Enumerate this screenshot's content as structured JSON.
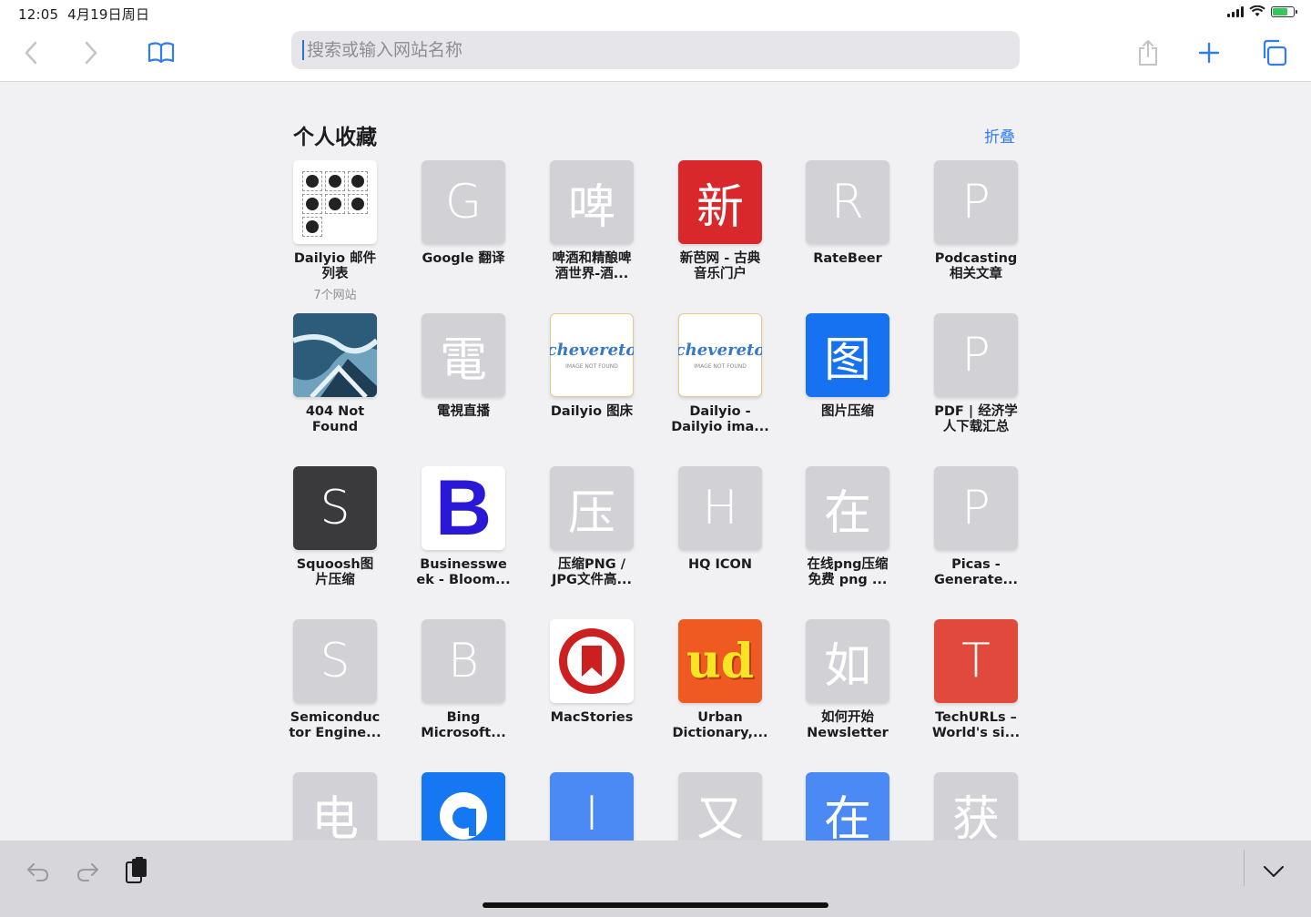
{
  "status": {
    "time": "12:05",
    "date": "4月19日周日"
  },
  "toolbar": {
    "address_placeholder": "搜索或输入网站名称"
  },
  "favorites": {
    "title": "个人收藏",
    "collapse_label": "折叠",
    "items": [
      {
        "label": "Dailyio 邮件\n列表",
        "sub": "7个网站",
        "tile": "",
        "color": "#ffffff"
      },
      {
        "label": "Google 翻译",
        "tile": "G",
        "color": "#d2d2d6"
      },
      {
        "label": "啤酒和精酿啤\n酒世界-酒...",
        "tile": "啤",
        "color": "#d2d2d6"
      },
      {
        "label": "新芭网 - 古典\n音乐门户",
        "tile": "新",
        "color": "#d9282b"
      },
      {
        "label": "RateBeer",
        "tile": "R",
        "color": "#d2d2d6"
      },
      {
        "label": "Podcasting\n相关文章",
        "tile": "P",
        "color": "#d2d2d6"
      },
      {
        "label": "404 Not\nFound",
        "tile": "",
        "color": "#3d6d8c"
      },
      {
        "label": "電視直播",
        "tile": "電",
        "color": "#d2d2d6"
      },
      {
        "label": "Dailyio 图床",
        "tile": "chevereto",
        "color": "#ffffff"
      },
      {
        "label": "Dailyio -\nDailyio ima...",
        "tile": "chevereto",
        "color": "#ffffff"
      },
      {
        "label": "图片压缩",
        "tile": "图",
        "color": "#1672f0"
      },
      {
        "label": "PDF | 经济学\n人下载汇总",
        "tile": "P",
        "color": "#d2d2d6"
      },
      {
        "label": "Squoosh图\n片压缩",
        "tile": "S",
        "color": "#3a3a3c"
      },
      {
        "label": "Businesswe\nek - Bloom...",
        "tile": "B",
        "color": "#ffffff"
      },
      {
        "label": "压缩PNG /\nJPG文件高...",
        "tile": "压",
        "color": "#d2d2d6"
      },
      {
        "label": "HQ ICON",
        "tile": "H",
        "color": "#d2d2d6"
      },
      {
        "label": "在线png压缩\n免费 png ...",
        "tile": "在",
        "color": "#d2d2d6"
      },
      {
        "label": "Picas -\nGenerate...",
        "tile": "P",
        "color": "#d2d2d6"
      },
      {
        "label": "Semiconduc\ntor Engine...",
        "tile": "S",
        "color": "#d2d2d6"
      },
      {
        "label": "Bing\nMicrosoft...",
        "tile": "B",
        "color": "#d2d2d6"
      },
      {
        "label": "MacStories",
        "tile": "",
        "color": "#ffffff"
      },
      {
        "label": "Urban\nDictionary,...",
        "tile": "ud",
        "color": "#ef5a22"
      },
      {
        "label": "如何开始\nNewsletter",
        "tile": "如",
        "color": "#d2d2d6"
      },
      {
        "label": "TechURLs –\nWorld's si...",
        "tile": "T",
        "color": "#e0493b"
      },
      {
        "label": "",
        "tile": "电",
        "color": "#d2d2d6"
      },
      {
        "label": "",
        "tile": "",
        "color": "#1677f2"
      },
      {
        "label": "",
        "tile": "I",
        "color": "#4b8af5"
      },
      {
        "label": "",
        "tile": "又",
        "color": "#d2d2d6"
      },
      {
        "label": "",
        "tile": "在",
        "color": "#4b8af5"
      },
      {
        "label": "",
        "tile": "获",
        "color": "#d2d2d6"
      }
    ]
  },
  "chevereto": {
    "brand": "chevereto",
    "note": "IMAGE NOT FOUND"
  }
}
